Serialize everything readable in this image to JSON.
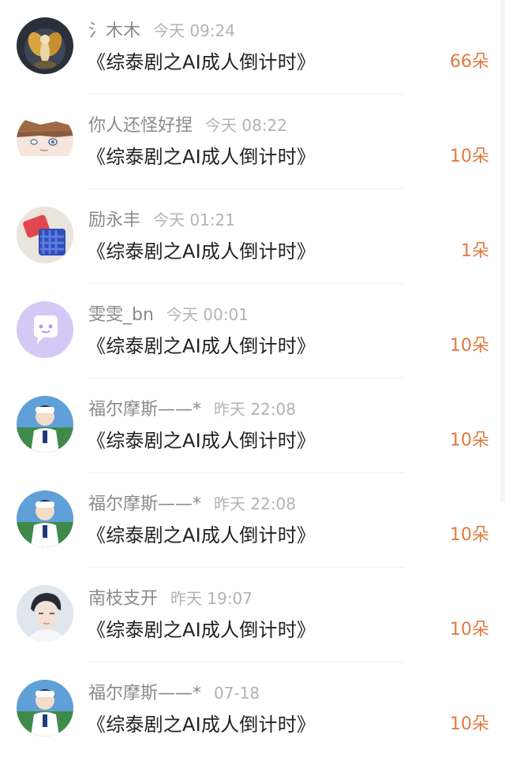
{
  "list": {
    "items": [
      {
        "username": "氵木木",
        "time": "今天 09:24",
        "gift": "《综泰剧之AI成人倒计时》",
        "amount": "66朵",
        "avatar": "firefly-fairy-avatar"
      },
      {
        "username": "你人还怪好捏",
        "time": "今天 08:22",
        "gift": "《综泰剧之AI成人倒计时》",
        "amount": "10朵",
        "avatar": "anime-boy-avatar"
      },
      {
        "username": "励永丰",
        "time": "今天 01:21",
        "gift": "《综泰剧之AI成人倒计时》",
        "amount": "1朵",
        "avatar": "woven-basket-avatar"
      },
      {
        "username": "雯雯_bn",
        "time": "今天 00:01",
        "gift": "《综泰剧之AI成人倒计时》",
        "amount": "10朵",
        "avatar": "default-chat-avatar"
      },
      {
        "username": "福尔摩斯——*",
        "time": "昨天 22:08",
        "gift": "《综泰剧之AI成人倒计时》",
        "amount": "10朵",
        "avatar": "tennis-player-avatar"
      },
      {
        "username": "福尔摩斯——*",
        "time": "昨天 22:08",
        "gift": "《综泰剧之AI成人倒计时》",
        "amount": "10朵",
        "avatar": "tennis-player-avatar"
      },
      {
        "username": "南枝支开",
        "time": "昨天 19:07",
        "gift": "《综泰剧之AI成人倒计时》",
        "amount": "10朵",
        "avatar": "portrait-avatar"
      },
      {
        "username": "福尔摩斯——*",
        "time": "07-18",
        "gift": "《综泰剧之AI成人倒计时》",
        "amount": "10朵",
        "avatar": "tennis-player-avatar"
      }
    ]
  },
  "colors": {
    "amount": "#e07b3e",
    "username": "#8a8a8a",
    "time": "#b3b3b3",
    "title": "#222222"
  }
}
